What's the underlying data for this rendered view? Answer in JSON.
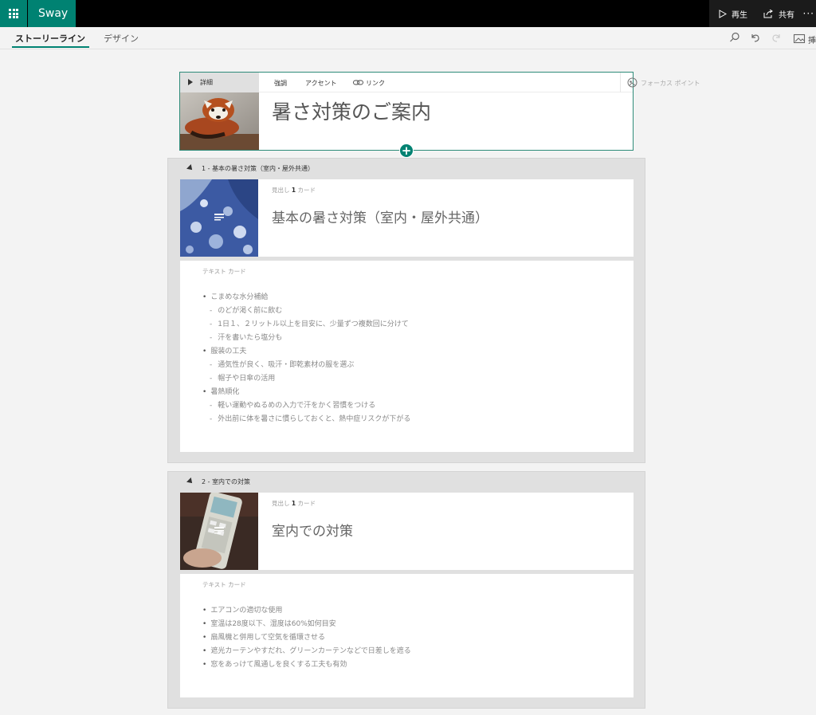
{
  "app": {
    "brand": "Sway",
    "play_label": "再生",
    "share_label": "共有",
    "more_label": "···"
  },
  "tabs": {
    "storyline": "ストーリーライン",
    "design": "デザイン",
    "insert": "挿"
  },
  "title_card": {
    "details_label": "詳細",
    "format": {
      "emphasis": "強調",
      "accent": "アクセント",
      "link": "リンク"
    },
    "focus_point": "フォーカス ポイント",
    "title": "暑さ対策のご案内",
    "add_button": "+"
  },
  "sections": [
    {
      "header": "1 - 基本の暑さ対策（室内・屋外共通）",
      "heading_card": {
        "type_prefix": "見出し ",
        "type_num": "1",
        "type_suffix": " カード",
        "heading": "基本の暑さ対策（室内・屋外共通）"
      },
      "text_card": {
        "type_label": "テキスト カード",
        "items": [
          {
            "level": 1,
            "text": "こまめな水分補給"
          },
          {
            "level": 2,
            "text": "のどが渇く前に飲む"
          },
          {
            "level": 2,
            "text": "1日１、２リットル以上を目安に、少量ずつ複数回に分けて"
          },
          {
            "level": 2,
            "text": "汗を書いたら塩分も"
          },
          {
            "level": 1,
            "text": "服装の工夫"
          },
          {
            "level": 2,
            "text": "通気性が良く、吸汗・即乾素材の服を選ぶ"
          },
          {
            "level": 2,
            "text": "帽子や日傘の活用"
          },
          {
            "level": 1,
            "text": "暑熱順化"
          },
          {
            "level": 2,
            "text": "軽い運動やぬるめの入力で汗をかく習慣をつける"
          },
          {
            "level": 2,
            "text": "外出前に体を暑さに慣らしておくと、熱中症リスクが下がる"
          }
        ]
      }
    },
    {
      "header": "2 - 室内での対策",
      "heading_card": {
        "type_prefix": "見出し ",
        "type_num": "1",
        "type_suffix": " カード",
        "heading": "室内での対策"
      },
      "text_card": {
        "type_label": "テキスト カード",
        "items": [
          {
            "level": 1,
            "text": "エアコンの適切な使用"
          },
          {
            "level": 1,
            "text": "室温は28度以下、湿度は60%如何目安"
          },
          {
            "level": 1,
            "text": "扇風機と併用して空気を循環させる"
          },
          {
            "level": 1,
            "text": "遮光カーテンやすだれ、グリーンカーテンなどで日差しを遮る"
          },
          {
            "level": 1,
            "text": "窓をあっけて風通しを良くする工夫も有効"
          }
        ]
      }
    }
  ],
  "colors": {
    "accent": "#008272",
    "topbar": "#000000"
  }
}
